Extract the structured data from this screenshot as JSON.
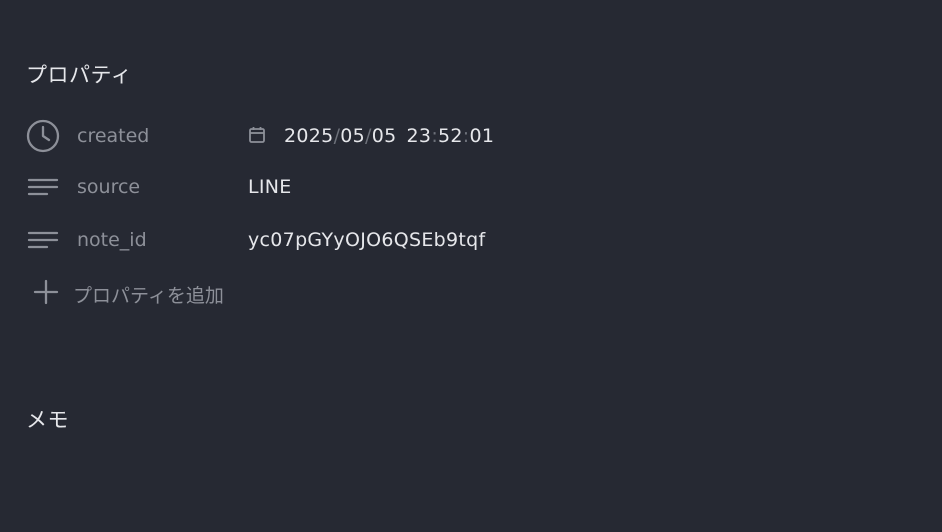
{
  "properties_section": {
    "title": "プロパティ",
    "rows": [
      {
        "key": "created",
        "icon": "clock-icon",
        "value_icon": "calendar-icon",
        "value": {
          "year": "2025",
          "month": "05",
          "day": "05",
          "hour": "23",
          "minute": "52",
          "second": "01",
          "date_sep": "/",
          "time_sep": ":"
        }
      },
      {
        "key": "source",
        "icon": "text-lines-icon",
        "value": "LINE"
      },
      {
        "key": "note_id",
        "icon": "text-lines-icon",
        "value": "yc07pGYyOJO6QSEb9tqf"
      }
    ],
    "add_label": "プロパティを追加",
    "add_icon": "plus-icon"
  },
  "memo_section": {
    "title": "メモ"
  }
}
